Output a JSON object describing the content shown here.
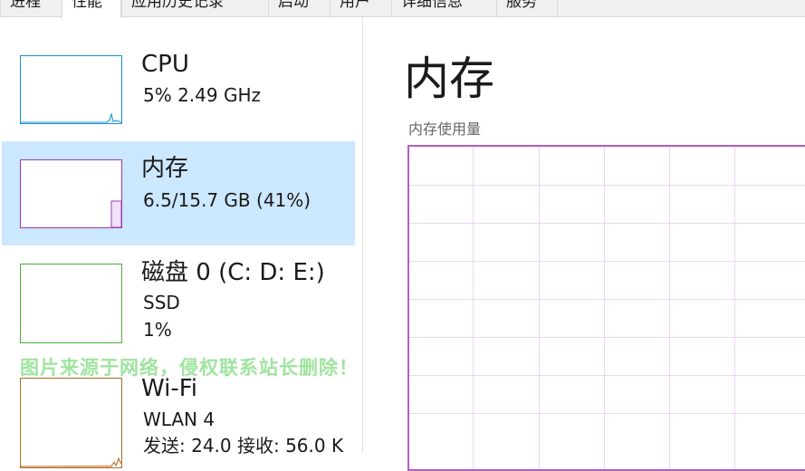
{
  "tabs": [
    {
      "label": "进程",
      "active": false
    },
    {
      "label": "性能",
      "active": true
    },
    {
      "label": "应用历史记录",
      "active": false
    },
    {
      "label": "启动",
      "active": false
    },
    {
      "label": "用户",
      "active": false
    },
    {
      "label": "详细信息",
      "active": false
    },
    {
      "label": "服务",
      "active": false
    }
  ],
  "sidebar": {
    "items": [
      {
        "title": "CPU",
        "line1": "5%  2.49 GHz",
        "line2": "",
        "color": "#1a8fd2"
      },
      {
        "title": "内存",
        "line1": "6.5/15.7 GB (41%)",
        "line2": "",
        "color": "#9b3ab0",
        "selected": true
      },
      {
        "title": "磁盘 0 (C: D: E:)",
        "line1": "SSD",
        "line2": "1%",
        "color": "#4dad3b"
      },
      {
        "title": "Wi-Fi",
        "line1": "WLAN 4",
        "line2": "发送: 24.0  接收: 56.0 K",
        "color": "#b26a25"
      }
    ]
  },
  "main": {
    "title": "内存",
    "graph_label": "内存使用量",
    "graph_color": "#b15fc1"
  },
  "watermark": "图片来源于网络，侵权联系站长删除！"
}
